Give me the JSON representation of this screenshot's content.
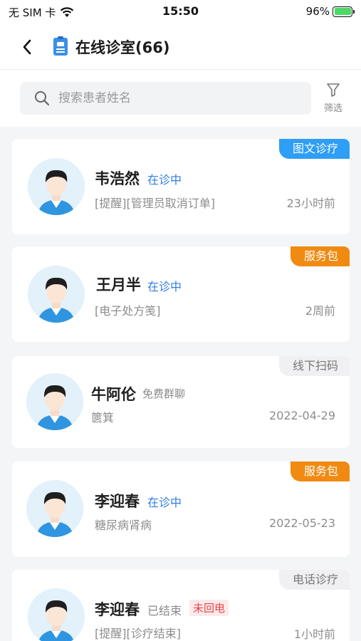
{
  "status_bar": {
    "carrier": "无 SIM 卡",
    "time": "15:50",
    "battery": "96%"
  },
  "header": {
    "title": "在线诊室(66)"
  },
  "search": {
    "placeholder": "搜索患者姓名",
    "filter_label": "筛选"
  },
  "patients": [
    {
      "name": "韦浩然",
      "status": "在诊中",
      "tag": "图文诊疗",
      "desc": "[提醒][管理员取消订单]",
      "time": "23小时前"
    },
    {
      "name": "王月半",
      "status": "在诊中",
      "tag": "服务包",
      "desc": "[电子处方笺]",
      "time": "2周前"
    },
    {
      "name": "牛阿伦",
      "status": "免费群聊",
      "tag": "线下扫码",
      "desc": "篋箕",
      "time": "2022-04-29"
    },
    {
      "name": "李迎春",
      "status": "在诊中",
      "tag": "服务包",
      "desc": "糖尿病肾病",
      "time": "2022-05-23"
    },
    {
      "name": "李迎春",
      "status": "已结束",
      "missed": "未回电",
      "tag": "电话诊疗",
      "desc": "[提醒][诊疗结束]",
      "time": "1小时前"
    }
  ],
  "colors": {
    "accent_blue": "#2e9ef6",
    "status_blue": "#2f7de6",
    "tag_orange": "#f08a11",
    "missed_red": "#e8474b"
  }
}
